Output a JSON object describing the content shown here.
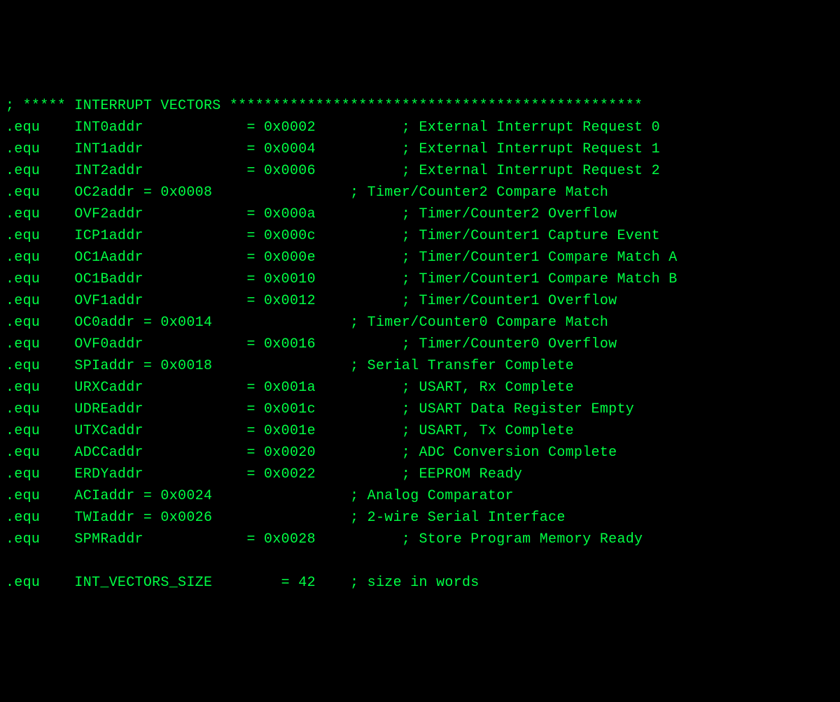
{
  "header": "; ***** INTERRUPT VECTORS ************************************************",
  "directive": ".equ",
  "vectors": [
    {
      "name": "INT0addr",
      "value": "0x0002",
      "comment": "External Interrupt Request 0",
      "align": "long"
    },
    {
      "name": "INT1addr",
      "value": "0x0004",
      "comment": "External Interrupt Request 1",
      "align": "long"
    },
    {
      "name": "INT2addr",
      "value": "0x0006",
      "comment": "External Interrupt Request 2",
      "align": "long"
    },
    {
      "name": "OC2addr",
      "value": "0x0008",
      "comment": "Timer/Counter2 Compare Match",
      "align": "short"
    },
    {
      "name": "OVF2addr",
      "value": "0x000a",
      "comment": "Timer/Counter2 Overflow",
      "align": "long"
    },
    {
      "name": "ICP1addr",
      "value": "0x000c",
      "comment": "Timer/Counter1 Capture Event",
      "align": "long"
    },
    {
      "name": "OC1Aaddr",
      "value": "0x000e",
      "comment": "Timer/Counter1 Compare Match A",
      "align": "long"
    },
    {
      "name": "OC1Baddr",
      "value": "0x0010",
      "comment": "Timer/Counter1 Compare Match B",
      "align": "long"
    },
    {
      "name": "OVF1addr",
      "value": "0x0012",
      "comment": "Timer/Counter1 Overflow",
      "align": "long"
    },
    {
      "name": "OC0addr",
      "value": "0x0014",
      "comment": "Timer/Counter0 Compare Match",
      "align": "short"
    },
    {
      "name": "OVF0addr",
      "value": "0x0016",
      "comment": "Timer/Counter0 Overflow",
      "align": "long"
    },
    {
      "name": "SPIaddr",
      "value": "0x0018",
      "comment": "Serial Transfer Complete",
      "align": "short"
    },
    {
      "name": "URXCaddr",
      "value": "0x001a",
      "comment": "USART, Rx Complete",
      "align": "long"
    },
    {
      "name": "UDREaddr",
      "value": "0x001c",
      "comment": "USART Data Register Empty",
      "align": "long"
    },
    {
      "name": "UTXCaddr",
      "value": "0x001e",
      "comment": "USART, Tx Complete",
      "align": "long"
    },
    {
      "name": "ADCCaddr",
      "value": "0x0020",
      "comment": "ADC Conversion Complete",
      "align": "long"
    },
    {
      "name": "ERDYaddr",
      "value": "0x0022",
      "comment": "EEPROM Ready",
      "align": "long"
    },
    {
      "name": "ACIaddr",
      "value": "0x0024",
      "comment": "Analog Comparator",
      "align": "short"
    },
    {
      "name": "TWIaddr",
      "value": "0x0026",
      "comment": "2-wire Serial Interface",
      "align": "short"
    },
    {
      "name": "SPMRaddr",
      "value": "0x0028",
      "comment": "Store Program Memory Ready",
      "align": "long"
    }
  ],
  "footer": {
    "name": "INT_VECTORS_SIZE",
    "value": "42",
    "comment": "size in words"
  }
}
